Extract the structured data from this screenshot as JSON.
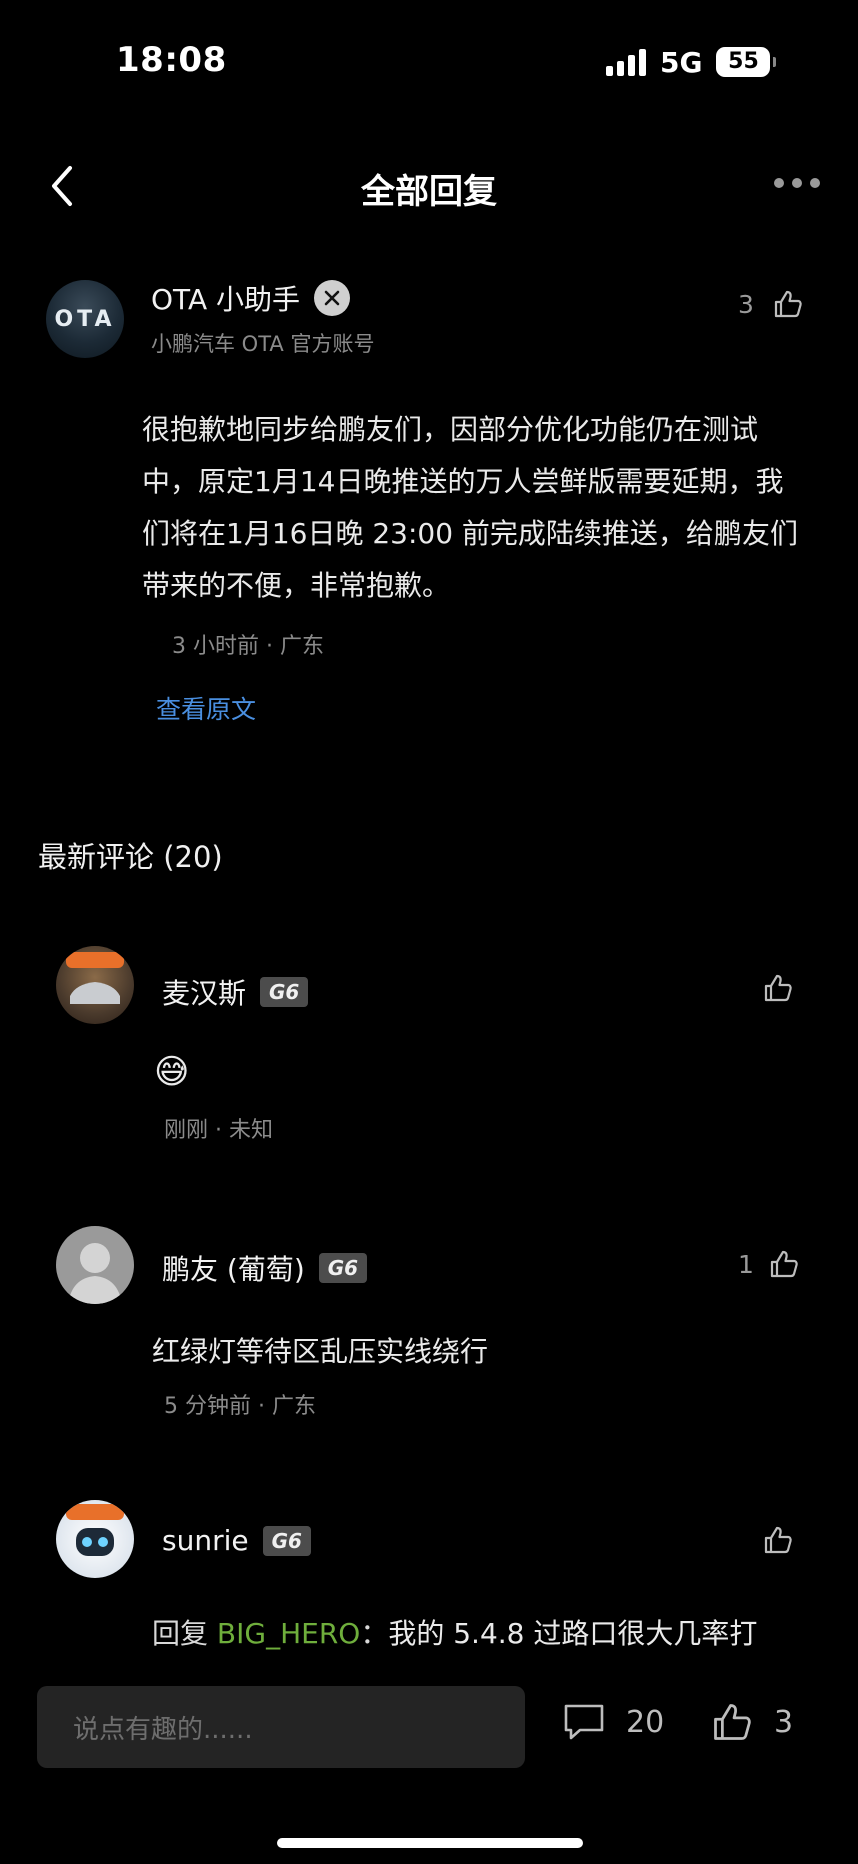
{
  "status_bar": {
    "time": "18:08",
    "network": "5G",
    "battery": "55"
  },
  "header": {
    "title": "全部回复"
  },
  "post": {
    "avatar_text": "OTA",
    "author": "OTA 小助手",
    "subtitle": "小鹏汽车 OTA 官方账号",
    "likes": "3",
    "body": "很抱歉地同步给鹏友们，因部分优化功能仍在测试中，原定1月14日晚推送的万人尝鲜版需要延期，我们将在1月16日晚 23:00 前完成陆续推送，给鹏友们带来的不便，非常抱歉。",
    "meta": "3 小时前 · 广东",
    "view_original": "查看原文"
  },
  "comments_section": {
    "title": "最新评论 (20)"
  },
  "comments": [
    {
      "name": "麦汉斯",
      "badge": "G6",
      "likes": "",
      "text": "😅",
      "meta": "刚刚 · 未知"
    },
    {
      "name": "鹏友 (葡萄)",
      "badge": "G6",
      "likes": "1",
      "text": "红绿灯等待区乱压实线绕行",
      "meta": "5 分钟前 · 广东"
    },
    {
      "name": "sunrie",
      "badge": "G6",
      "likes": "",
      "reply_prefix": "回复 ",
      "reply_target": "BIG_HERO",
      "reply_sep": "：",
      "text": "我的 5.4.8 过路口很大几率打"
    }
  ],
  "bottom_bar": {
    "input_placeholder": "说点有趣的......",
    "comment_count": "20",
    "like_count": "3"
  },
  "icons": [
    "back-icon",
    "more-icon",
    "verify-icon",
    "like-icon",
    "comment-icon"
  ]
}
